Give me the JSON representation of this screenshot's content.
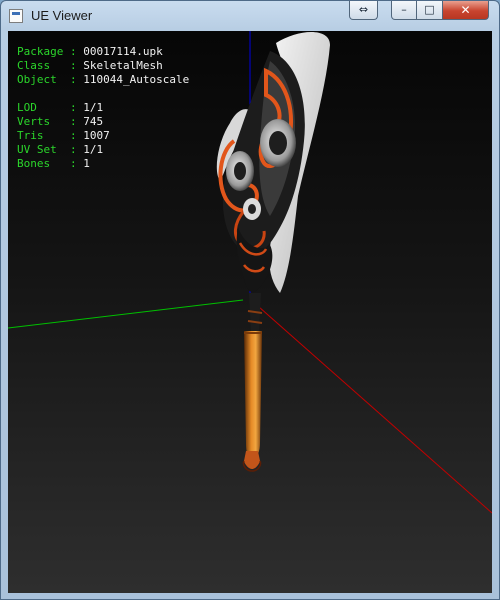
{
  "window": {
    "title": "UE Viewer",
    "buttons": {
      "fullscreen_glyph": "⇔",
      "minimize_glyph": "–",
      "maximize_glyph": "□",
      "close_glyph": "✕"
    }
  },
  "colors": {
    "label_green": "#2bd62b",
    "value_white": "#f2f2f2",
    "axis_x": "#c00000",
    "axis_y": "#00c000",
    "axis_z": "#0000e0",
    "close_red": "#c8442f"
  },
  "info": {
    "package": {
      "label": "Package",
      "value": "00017114.upk"
    },
    "class": {
      "label": "Class  ",
      "value": "SkeletalMesh"
    },
    "object": {
      "label": "Object ",
      "value": "110044_Autoscale"
    },
    "lod": {
      "label": "LOD    ",
      "value": "1/1"
    },
    "verts": {
      "label": "Verts  ",
      "value": "745"
    },
    "tris": {
      "label": "Tris   ",
      "value": "1007"
    },
    "uvset": {
      "label": "UV Set ",
      "value": "1/1"
    },
    "bones": {
      "label": "Bones  ",
      "value": "1"
    },
    "separator": " : "
  }
}
